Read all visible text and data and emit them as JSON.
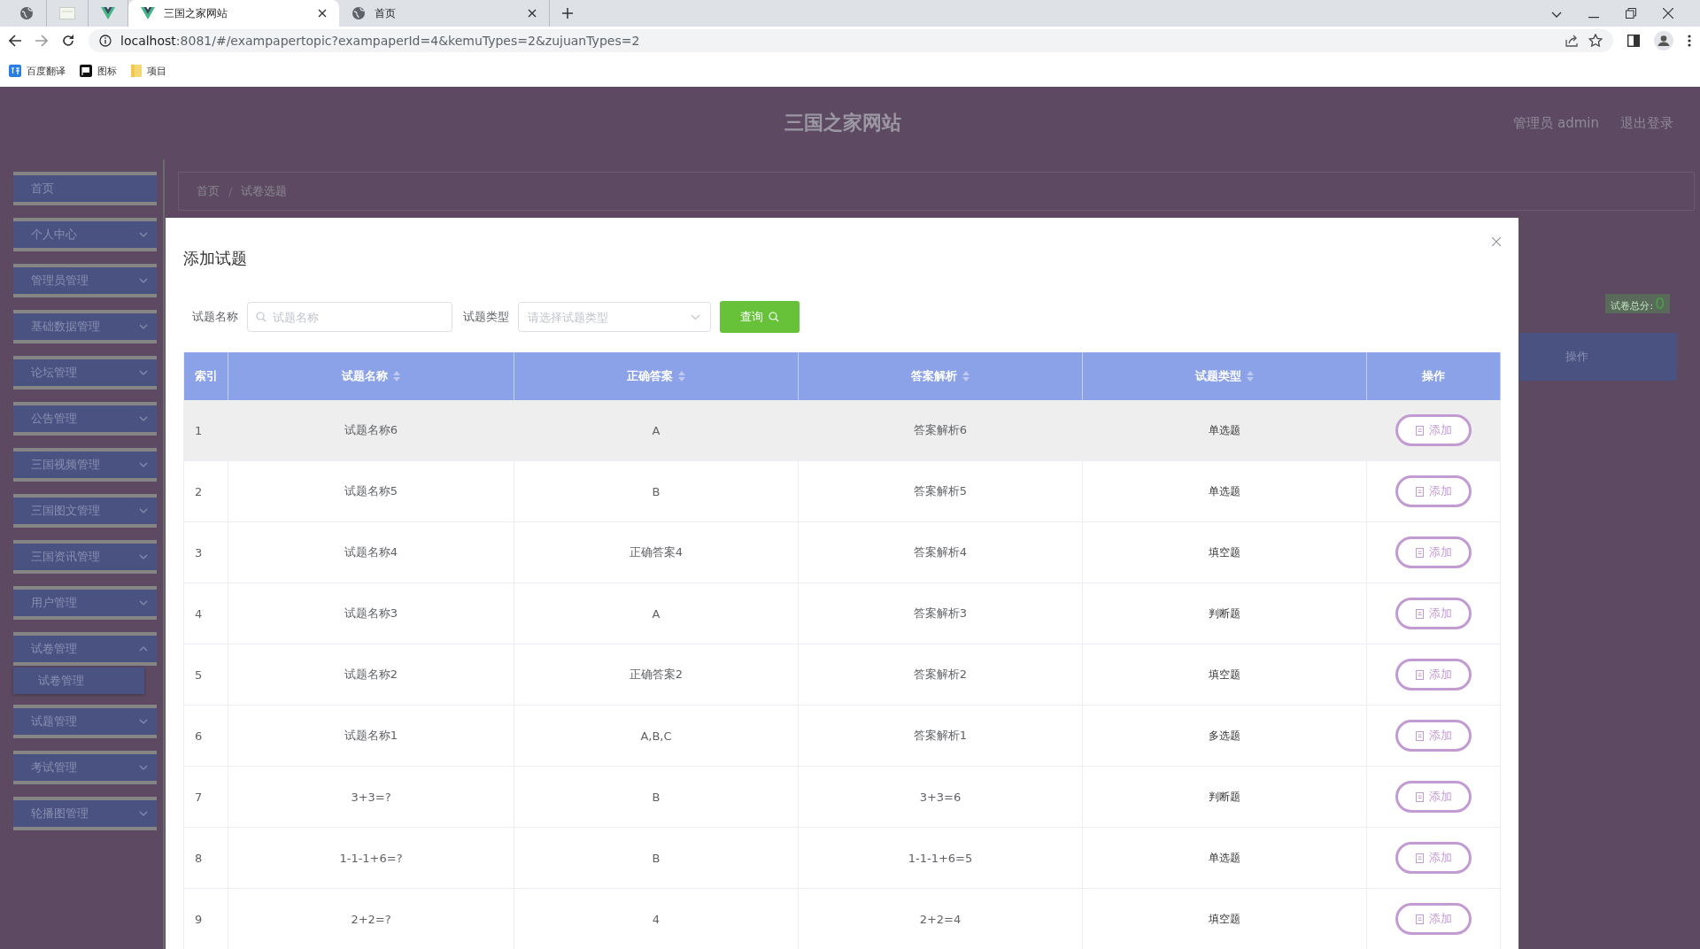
{
  "browser": {
    "tabs": [
      {
        "kind": "globe",
        "selected": false
      },
      {
        "kind": "page",
        "selected": false
      },
      {
        "kind": "vue",
        "selected": false
      },
      {
        "kind": "vue",
        "title": "三国之家网站",
        "selected": true
      },
      {
        "kind": "globe",
        "title": "首页",
        "selected": false
      }
    ],
    "url_host": "localhost",
    "url_rest": ":8081/#/exampapertopic?exampaperId=4&kemuTypes=2&zujuanTypes=2",
    "bookmarks": [
      {
        "kind": "translate",
        "label": "百度翻译"
      },
      {
        "kind": "flag",
        "label": "图标"
      },
      {
        "kind": "folder",
        "label": "项目"
      }
    ]
  },
  "header": {
    "title": "三国之家网站",
    "user": "管理员 admin",
    "logout": "退出登录"
  },
  "sidebar": {
    "items": [
      {
        "label": "首页",
        "kind": "link"
      },
      {
        "label": "个人中心",
        "kind": "menu",
        "expanded": false
      },
      {
        "label": "管理员管理",
        "kind": "menu",
        "expanded": false
      },
      {
        "label": "基础数据管理",
        "kind": "menu",
        "expanded": false
      },
      {
        "label": "论坛管理",
        "kind": "menu",
        "expanded": false
      },
      {
        "label": "公告管理",
        "kind": "menu",
        "expanded": false
      },
      {
        "label": "三国视频管理",
        "kind": "menu",
        "expanded": false
      },
      {
        "label": "三国图文管理",
        "kind": "menu",
        "expanded": false
      },
      {
        "label": "三国资讯管理",
        "kind": "menu",
        "expanded": false
      },
      {
        "label": "用户管理",
        "kind": "menu",
        "expanded": false
      },
      {
        "label": "试卷管理",
        "kind": "menu",
        "expanded": true,
        "children": [
          {
            "label": "试卷管理"
          }
        ]
      },
      {
        "label": "试题管理",
        "kind": "menu",
        "expanded": false
      },
      {
        "label": "考试管理",
        "kind": "menu",
        "expanded": false
      },
      {
        "label": "轮播图管理",
        "kind": "menu",
        "expanded": false
      }
    ]
  },
  "breadcrumb": [
    "首页",
    "试卷选题"
  ],
  "breadcrumb_separator": "/",
  "score": {
    "label": "试卷总分:",
    "value": "0"
  },
  "background_table": {
    "column": "操作"
  },
  "dialog": {
    "title": "添加试题",
    "filters": [
      {
        "kind": "text",
        "label": "试题名称",
        "placeholder": "试题名称"
      },
      {
        "kind": "select",
        "label": "试题类型",
        "placeholder": "请选择试题类型"
      }
    ],
    "search_button": "查询",
    "table": {
      "columns": [
        {
          "label": "索引",
          "sortable": false
        },
        {
          "label": "试题名称",
          "sortable": true
        },
        {
          "label": "正确答案",
          "sortable": true
        },
        {
          "label": "答案解析",
          "sortable": true
        },
        {
          "label": "试题类型",
          "sortable": true
        },
        {
          "label": "操作",
          "sortable": false
        }
      ],
      "rows": [
        {
          "index": "1",
          "name": "试题名称6",
          "answer": "A",
          "analysis": "答案解析6",
          "type": "单选题",
          "action": "添加",
          "hovered": true
        },
        {
          "index": "2",
          "name": "试题名称5",
          "answer": "B",
          "analysis": "答案解析5",
          "type": "单选题",
          "action": "添加",
          "hovered": false
        },
        {
          "index": "3",
          "name": "试题名称4",
          "answer": "正确答案4",
          "analysis": "答案解析4",
          "type": "填空题",
          "action": "添加",
          "hovered": false
        },
        {
          "index": "4",
          "name": "试题名称3",
          "answer": "A",
          "analysis": "答案解析3",
          "type": "判断题",
          "action": "添加",
          "hovered": false
        },
        {
          "index": "5",
          "name": "试题名称2",
          "answer": "正确答案2",
          "analysis": "答案解析2",
          "type": "填空题",
          "action": "添加",
          "hovered": false
        },
        {
          "index": "6",
          "name": "试题名称1",
          "answer": "A,B,C",
          "analysis": "答案解析1",
          "type": "多选题",
          "action": "添加",
          "hovered": false
        },
        {
          "index": "7",
          "name": "3+3=?",
          "answer": "B",
          "analysis": "3+3=6",
          "type": "判断题",
          "action": "添加",
          "hovered": false
        },
        {
          "index": "8",
          "name": "1-1-1+6=?",
          "answer": "B",
          "analysis": "1-1-1+6=5",
          "type": "单选题",
          "action": "添加",
          "hovered": false
        },
        {
          "index": "9",
          "name": "2+2=?",
          "answer": "4",
          "analysis": "2+2=4",
          "type": "填空题",
          "action": "添加",
          "hovered": false
        }
      ]
    }
  }
}
